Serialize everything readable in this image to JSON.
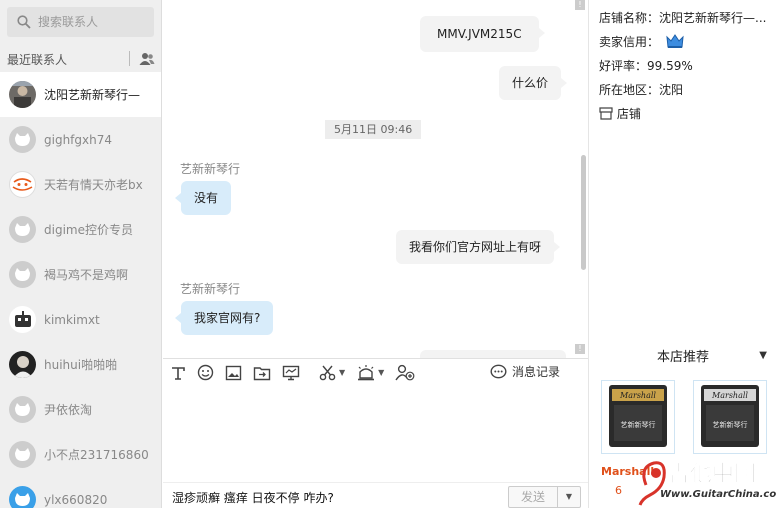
{
  "sidebar": {
    "search_placeholder": "搜索联系人",
    "recent_label": "最近联系人",
    "contacts": [
      {
        "name": "沈阳艺新新琴行—",
        "active": true,
        "avatar": "photo-avatar"
      },
      {
        "name": "gighfgxh74",
        "active": false,
        "avatar": "default-avatar"
      },
      {
        "name": "天若有情天亦老bx",
        "active": false,
        "avatar": "taobao-avatar"
      },
      {
        "name": "digime控价专员",
        "active": false,
        "avatar": "default-avatar"
      },
      {
        "name": "褐马鸡不是鸡啊",
        "active": false,
        "avatar": "default-avatar"
      },
      {
        "name": "kimkimxt",
        "active": false,
        "avatar": "robot-avatar"
      },
      {
        "name": "huihui啪啪啪",
        "active": false,
        "avatar": "photo-avatar"
      },
      {
        "name": "尹依依淘",
        "active": false,
        "avatar": "default-avatar"
      },
      {
        "name": "小不点231716860",
        "active": false,
        "avatar": "default-avatar"
      },
      {
        "name": "ylx660820",
        "active": false,
        "avatar": "blue-avatar"
      }
    ]
  },
  "chat": {
    "messages": [
      {
        "dir": "out",
        "text": "MMV.JVM215C"
      },
      {
        "dir": "out",
        "text": "什么价"
      },
      {
        "type": "time",
        "text": "5月11日 09:46"
      },
      {
        "dir": "in",
        "sender": "艺新新琴行",
        "text": "没有"
      },
      {
        "dir": "out",
        "text": "我看你们官方网址上有呀"
      },
      {
        "dir": "in",
        "sender": "艺新新琴行",
        "text": "我家官网有?"
      }
    ]
  },
  "toolbar": {
    "icons": [
      "font-icon",
      "emoji-icon",
      "image-icon",
      "file-transfer-icon",
      "screen-share-icon",
      "scissors-icon",
      "shake-icon",
      "add-contact-icon"
    ],
    "history_label": "消息记录"
  },
  "input": {
    "draft_text": "湿疹顽癣 瘙痒 日夜不停 咋办?",
    "send_label": "发送"
  },
  "shop": {
    "name_label": "店铺名称：沈阳艺新新琴行—...",
    "credit_label": "卖家信用：",
    "rating_label": "好评率：99.59%",
    "region_label": "所在地区：沈阳",
    "shop_link": "店铺",
    "recommend_title": "本店推荐",
    "products": [
      {
        "brand": "Marshall",
        "logo_text": "艺新新琴行"
      },
      {
        "brand": "Marshall",
        "logo_text": "艺新新琴行"
      }
    ],
    "product_label": "Marshall",
    "product_price": "6",
    "watermark_text": "吉他中国",
    "watermark_url": "Www.GuitarChina.com"
  },
  "colors": {
    "incoming_bubble": "#d8ecfa",
    "outgoing_bubble": "#f3f3f3",
    "sidebar_bg": "#efefef",
    "price_orange": "#e0501a"
  }
}
